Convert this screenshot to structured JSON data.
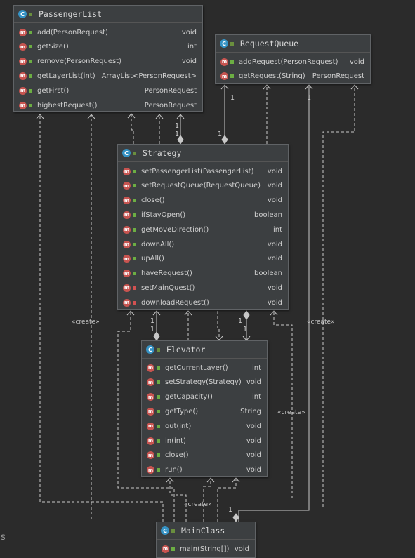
{
  "classes": {
    "passengerList": {
      "name": "PassengerList",
      "methods": [
        {
          "name": "add(PersonRequest)",
          "type": "void",
          "vis": "public"
        },
        {
          "name": "getSize()",
          "type": "int",
          "vis": "public"
        },
        {
          "name": "remove(PersonRequest)",
          "type": "void",
          "vis": "public"
        },
        {
          "name": "getLayerList(int)",
          "type": "ArrayList<PersonRequest>",
          "vis": "public"
        },
        {
          "name": "getFirst()",
          "type": "PersonRequest",
          "vis": "public"
        },
        {
          "name": "highestRequest()",
          "type": "PersonRequest",
          "vis": "public"
        }
      ]
    },
    "requestQueue": {
      "name": "RequestQueue",
      "methods": [
        {
          "name": "addRequest(PersonRequest)",
          "type": "void",
          "vis": "public"
        },
        {
          "name": "getRequest(String)",
          "type": "PersonRequest",
          "vis": "public"
        }
      ]
    },
    "strategy": {
      "name": "Strategy",
      "methods": [
        {
          "name": "setPassengerList(PassengerList)",
          "type": "void",
          "vis": "public"
        },
        {
          "name": "setRequestQueue(RequestQueue)",
          "type": "void",
          "vis": "public"
        },
        {
          "name": "close()",
          "type": "void",
          "vis": "public"
        },
        {
          "name": "ifStayOpen()",
          "type": "boolean",
          "vis": "public"
        },
        {
          "name": "getMoveDirection()",
          "type": "int",
          "vis": "public"
        },
        {
          "name": "downAll()",
          "type": "void",
          "vis": "public"
        },
        {
          "name": "upAll()",
          "type": "void",
          "vis": "public"
        },
        {
          "name": "haveRequest()",
          "type": "boolean",
          "vis": "public"
        },
        {
          "name": "setMainQuest()",
          "type": "void",
          "vis": "private"
        },
        {
          "name": "downloadRequest()",
          "type": "void",
          "vis": "private"
        }
      ]
    },
    "elevator": {
      "name": "Elevator",
      "methods": [
        {
          "name": "getCurrentLayer()",
          "type": "int",
          "vis": "public"
        },
        {
          "name": "setStrategy(Strategy)",
          "type": "void",
          "vis": "public"
        },
        {
          "name": "getCapacity()",
          "type": "int",
          "vis": "public"
        },
        {
          "name": "getType()",
          "type": "String",
          "vis": "public"
        },
        {
          "name": "out(int)",
          "type": "void",
          "vis": "public"
        },
        {
          "name": "in(int)",
          "type": "void",
          "vis": "public"
        },
        {
          "name": "close()",
          "type": "void",
          "vis": "public"
        },
        {
          "name": "run()",
          "type": "void",
          "vis": "public"
        }
      ]
    },
    "mainClass": {
      "name": "MainClass",
      "methods": [
        {
          "name": "main(String[])",
          "type": "void",
          "vis": "public"
        }
      ]
    }
  },
  "icons": {
    "class_icon": "C",
    "method_icon": "m"
  },
  "edge_labels": {
    "create": "«create»",
    "one": "1"
  },
  "side_letter": "s",
  "colors": {
    "background": "#2b2b2b",
    "panel": "#3c3f41",
    "class_icon": "#3592c4",
    "method_icon": "#c75450",
    "public_marker": "#6cae43",
    "private_marker": "#d25252",
    "edge": "#c8c8c8"
  }
}
